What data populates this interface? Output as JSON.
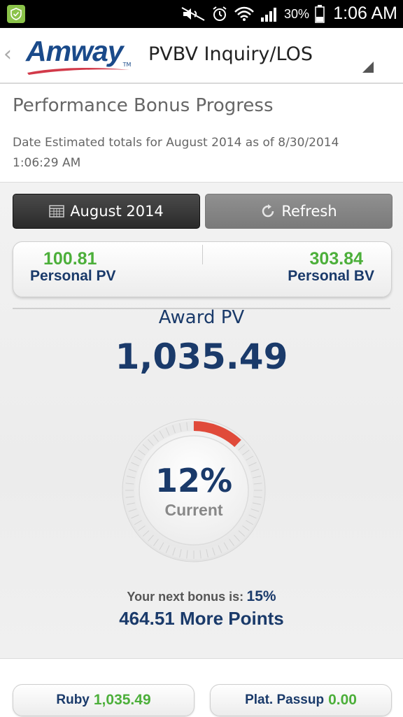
{
  "status_bar": {
    "battery": "30%",
    "time": "1:06 AM"
  },
  "app_bar": {
    "logo": "Amway",
    "logo_tm": "TM",
    "title": "PVBV Inquiry/LOS"
  },
  "header": {
    "title": "Performance Bonus Progress",
    "date_line": "Date Estimated totals for August 2014 as of 8/30/2014 1:06:29 AM"
  },
  "buttons": {
    "month": "August 2014",
    "refresh": "Refresh"
  },
  "personal": {
    "pv_value": "100.81",
    "pv_label": "Personal PV",
    "bv_value": "303.84",
    "bv_label": "Personal BV"
  },
  "award": {
    "label": "Award PV",
    "value": "1,035.49"
  },
  "dial": {
    "percent": "12%",
    "percent_fraction": 0.12,
    "caption": "Current"
  },
  "next_bonus": {
    "label": "Your next bonus is:",
    "value": "15%",
    "more_points": "464.51 More Points"
  },
  "bottom": {
    "ruby_label": "Ruby",
    "ruby_value": "1,035.49",
    "plat_label": "Plat. Passup",
    "plat_value": "0.00"
  },
  "colors": {
    "navy": "#1a3a6a",
    "green": "#4caf3a",
    "progress_red": "#e04a3a"
  }
}
